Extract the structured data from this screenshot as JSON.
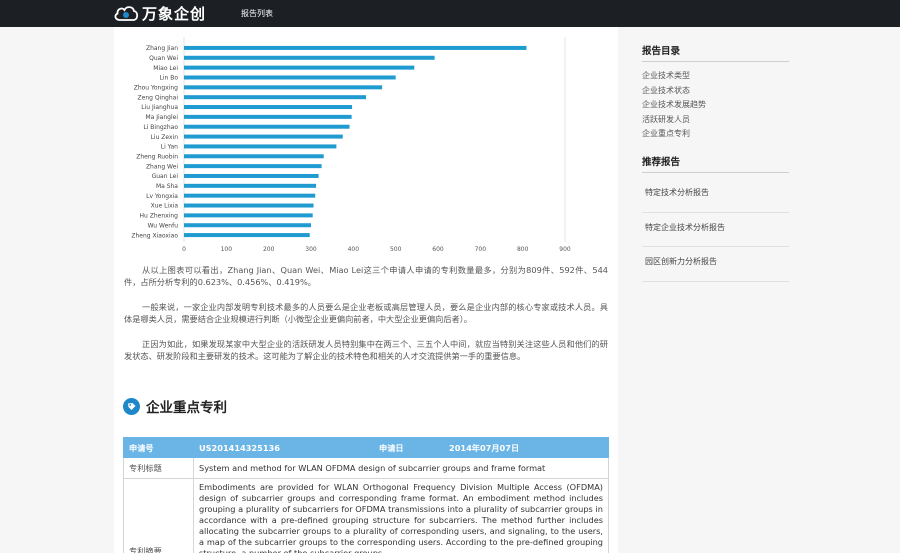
{
  "app": {
    "logo_text": "万象企创"
  },
  "nav": {
    "report_list": "报告列表"
  },
  "chart_data": {
    "type": "bar",
    "orientation": "horizontal",
    "categories": [
      "Zhang Jian",
      "Quan Wei",
      "Miao Lei",
      "Lin Bo",
      "Zhou Yongxing",
      "Zeng Qinghai",
      "Liu Jianghua",
      "Ma Jianglei",
      "Li Bingzhao",
      "Liu Zexin",
      "Li Yan",
      "Zheng Ruobin",
      "Zhang Wei",
      "Guan Lei",
      "Ma Sha",
      "Lv Yongxia",
      "Xue Lixia",
      "Hu Zhenxing",
      "Wu Wenfu",
      "Zheng Xiaoxiao"
    ],
    "values": [
      809,
      592,
      544,
      500,
      468,
      430,
      397,
      396,
      391,
      375,
      360,
      330,
      325,
      318,
      312,
      310,
      306,
      304,
      300,
      297
    ],
    "xlim": [
      0,
      900
    ],
    "xticks": [
      0,
      100,
      200,
      300,
      400,
      500,
      600,
      700,
      800,
      900
    ],
    "bar_color": "#1f9bd1",
    "grid": false
  },
  "paragraphs": [
    "从以上图表可以看出，Zhang Jian、Quan Wei、Miao Lei这三个申请人申请的专利数量最多，分别为809件、592件、544件，占所分析专利的0.623%、0.456%、0.419%。",
    "一般来说，一家企业内部发明专利技术最多的人员要么是企业老板或高层管理人员，要么是企业内部的核心专家或技术人员。具体是哪类人员，需要结合企业规模进行判断（小微型企业更偏向前者，中大型企业更偏向后者）。",
    "正因为如此，如果发现某家中大型企业的活跃研发人员特别集中在两三个、三五个人中间，就应当特别关注这些人员和他们的研发状态、研发阶段和主要研发的技术。这可能为了解企业的技术特色和相关的人才交流提供第一手的重要信息。"
  ],
  "section": {
    "title": "企业重点专利",
    "icon": "tag-icon"
  },
  "patent": {
    "app_no_label": "申请号",
    "app_no": "US201414325136",
    "app_date_label": "申请日",
    "app_date": "2014年07月07日",
    "title_label": "专利标题",
    "title": "System and method for WLAN OFDMA design of subcarrier groups and frame format",
    "abstract_label": "专利摘要",
    "abstract": "Embodiments are provided for WLAN Orthogonal Frequency Division Multiple Access (OFDMA) design of subcarrier groups and corresponding frame format. An embodiment method includes grouping a plurality of subcarriers for OFDMA transmissions into a plurality of subcarrier groups in accordance with a pre-defined grouping structure for subcarriers. The method further includes allocating the subcarrier groups to a plurality of corresponding users, and signaling, to the users, a map of the subcarrier groups to the corresponding users. According to the pre-defined grouping structure, a number of the subcarrier groups ... "
  },
  "sidebar": {
    "toc_title": "报告目录",
    "toc_items": [
      "企业技术类型",
      "企业技术状态",
      "企业技术发展趋势",
      "活跃研发人员",
      "企业重点专利"
    ],
    "rec_title": "推荐报告",
    "rec_items": [
      "特定技术分析报告",
      "特定企业技术分析报告",
      "园区创新力分析报告"
    ]
  },
  "colors": {
    "topbar": "#1c1f24",
    "accent": "#1e88c9",
    "table_header": "#6ab5e6"
  }
}
